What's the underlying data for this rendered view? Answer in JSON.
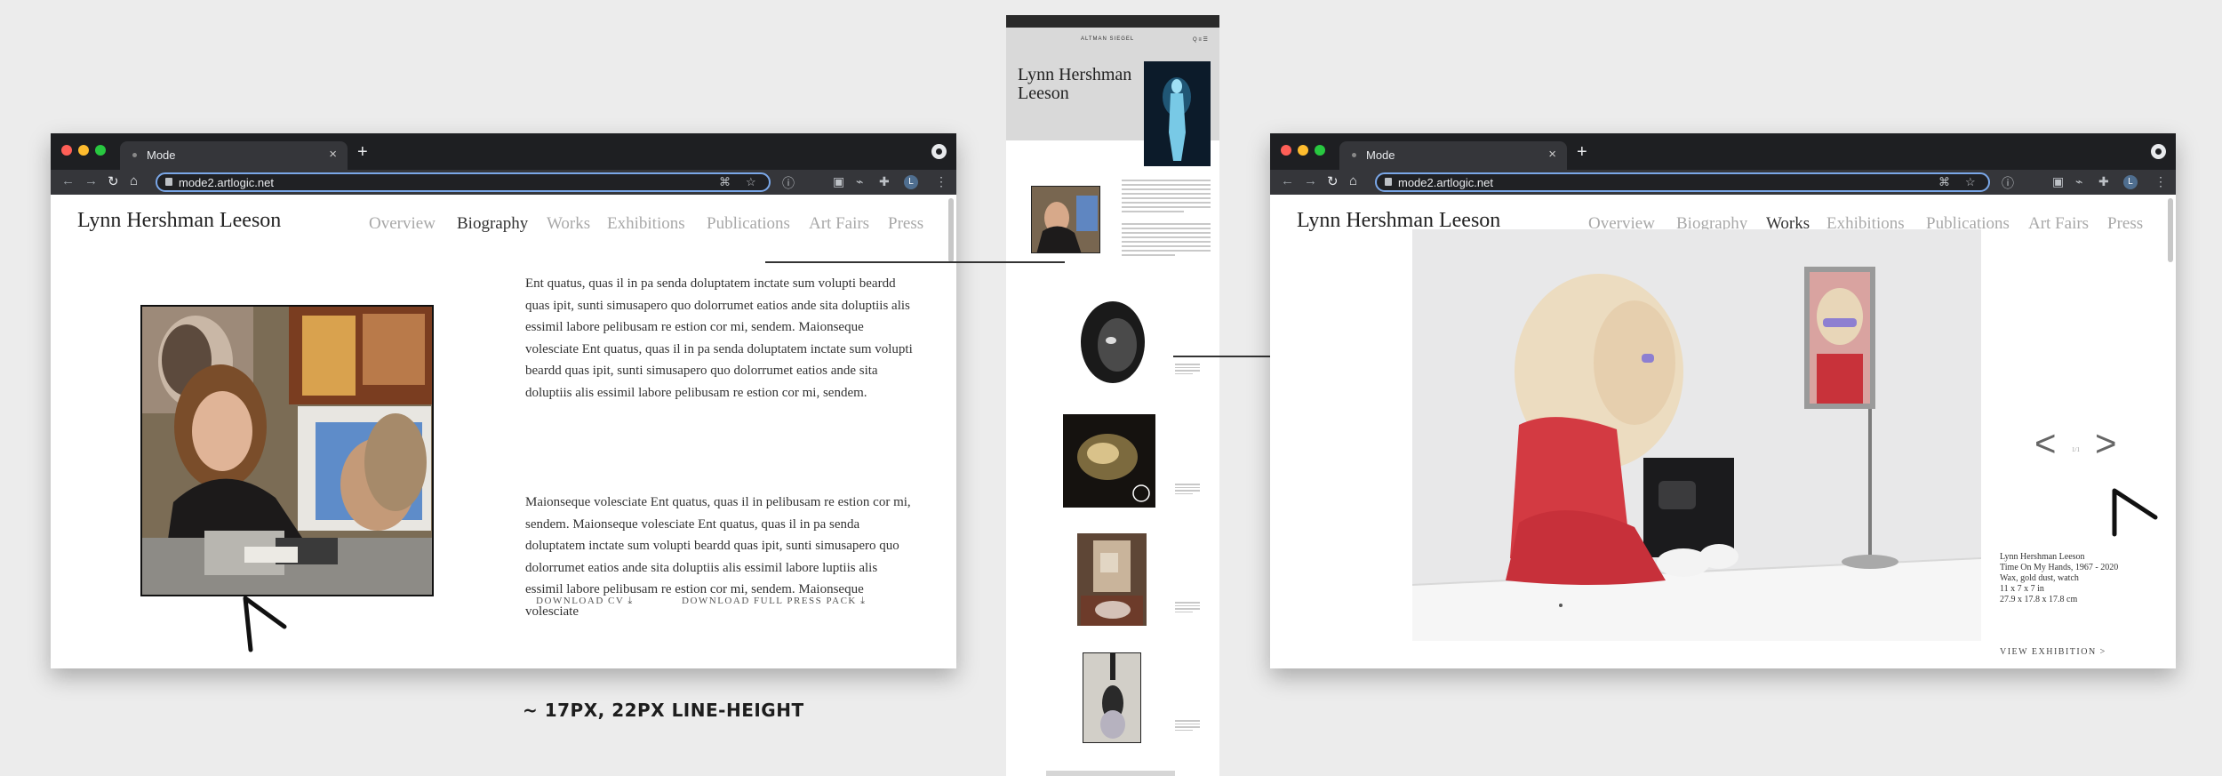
{
  "left_window": {
    "tab": {
      "title": "Mode",
      "close": "×"
    },
    "new_tab": "+",
    "address": "mode2.artlogic.net",
    "toolbar": {
      "back": "←",
      "forward": "→",
      "reload": "↻",
      "home": "⌂",
      "avatar": "L"
    },
    "site_title": "Lynn Hershman Leeson",
    "nav": [
      {
        "label": "Overview"
      },
      {
        "label": "Biography"
      },
      {
        "label": "Works"
      },
      {
        "label": "Exhibitions"
      },
      {
        "label": "Publications"
      },
      {
        "label": "Art Fairs"
      },
      {
        "label": "Press"
      }
    ],
    "active_nav": "Biography",
    "bio_paragraphs": [
      " Ent quatus, quas il in pa senda doluptatem inctate sum volupti beardd quas ipit, sunti simusapero quo dolorrumet eatios ande sita doluptiis alis essimil labore pelibusam re estion cor mi, sendem. Maionseque volesciate Ent quatus, quas il in pa senda doluptatem inctate sum volupti beardd quas ipit, sunti simusapero quo dolorrumet eatios ande sita doluptiis alis essimil labore pelibusam re estion cor mi, sendem.",
      "Maionseque volesciate Ent quatus, quas il in pelibusam re estion cor mi, sendem. Maionseque volesciate Ent quatus, quas il in pa senda doluptatem inctate sum volupti beardd quas ipit, sunti simusapero quo dolorrumet eatios ande sita doluptiis alis essimil labore luptiis alis essimil labore pelibusam re estion cor mi, sendem. Maionseque volesciate"
    ],
    "download_cv": "DOWNLOAD CV",
    "download_press": "DOWNLOAD FULL PRESS PACK"
  },
  "right_window": {
    "tab": {
      "title": "Mode",
      "close": "×"
    },
    "new_tab": "+",
    "address": "mode2.artlogic.net",
    "toolbar": {
      "back": "←",
      "forward": "→",
      "reload": "↻",
      "home": "⌂",
      "avatar": "L"
    },
    "site_title": "Lynn Hershman Leeson",
    "nav": [
      {
        "label": "Overview"
      },
      {
        "label": "Biography"
      },
      {
        "label": "Works"
      },
      {
        "label": "Exhibitions"
      },
      {
        "label": "Publications"
      },
      {
        "label": "Art Fairs"
      },
      {
        "label": "Press"
      }
    ],
    "active_nav": "Works",
    "prev": "<",
    "next": ">",
    "pager": "1/1",
    "caption": [
      "Lynn Hershman Leeson",
      "Time On My Hands, 1967 - 2020",
      "Wax, gold dust, watch",
      "11 x 7 x 7 in",
      "27.9 x 17.8 x 17.8 cm"
    ],
    "view_exhibition": "VIEW EXHIBITION >"
  },
  "mobile": {
    "brand": "ALTMAN SIEGEL",
    "icons": "Q ≡ ☰",
    "name": "Lynn Hershman Leeson"
  },
  "annotation": "~ 17PX, 22PX LINE-HEIGHT",
  "colors": {
    "browser_chrome": "#1e1f22",
    "toolbar": "#35363a",
    "omnibox_focus": "#7aa7e8",
    "nav_inactive": "#a8a8a8",
    "nav_active": "#333333",
    "background": "#ececec"
  }
}
